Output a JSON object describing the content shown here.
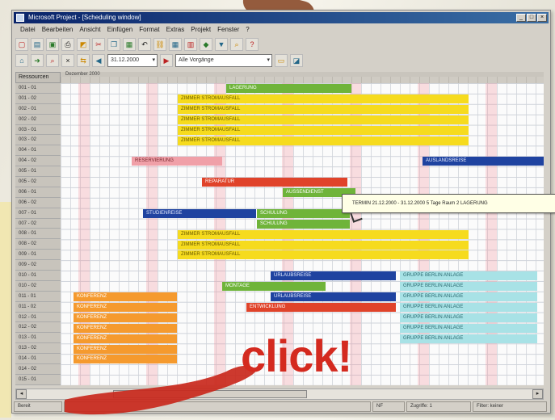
{
  "window": {
    "title": "Microsoft Project - [Scheduling window]"
  },
  "menu": [
    "Datei",
    "Bearbeiten",
    "Ansicht",
    "Einfügen",
    "Format",
    "Extras",
    "Projekt",
    "Fenster",
    "?"
  ],
  "toolbar": {
    "select1": "31.12.2000",
    "select2": "Alle Vorgänge"
  },
  "grid": {
    "left_header": "Ressourcen",
    "top_header": "Dezember 2000",
    "rows": [
      "001 - 01",
      "001 - 02",
      "002 - 01",
      "002 - 02",
      "003 - 01",
      "003 - 02",
      "004 - 01",
      "004 - 02",
      "005 - 01",
      "005 - 02",
      "006 - 01",
      "006 - 02",
      "007 - 01",
      "007 - 02",
      "008 - 01",
      "008 - 02",
      "009 - 01",
      "009 - 02",
      "010 - 01",
      "010 - 02",
      "011 - 01",
      "011 - 02",
      "012 - 01",
      "012 - 02",
      "013 - 01",
      "013 - 02",
      "014 - 01",
      "014 - 02",
      "015 - 01"
    ]
  },
  "bars": [
    {
      "color": "green",
      "label": "LAGERUNG",
      "row": 0,
      "start": 205,
      "width": 155
    },
    {
      "color": "yellow",
      "label": "ZIMMER STROMAUSFALL",
      "row": 1,
      "start": 145,
      "width": 360
    },
    {
      "color": "yellow",
      "label": "ZIMMER STROMAUSFALL",
      "row": 2,
      "start": 145,
      "width": 360
    },
    {
      "color": "yellow",
      "label": "ZIMMER STROMAUSFALL",
      "row": 3,
      "start": 145,
      "width": 360
    },
    {
      "color": "yellow",
      "label": "ZIMMER STROMAUSFALL",
      "row": 4,
      "start": 145,
      "width": 360
    },
    {
      "color": "yellow",
      "label": "ZIMMER STROMAUSFALL",
      "row": 5,
      "start": 145,
      "width": 360
    },
    {
      "color": "pink",
      "label": "RESERVIERUNG",
      "row": 7,
      "start": 88,
      "width": 112
    },
    {
      "color": "blue",
      "label": "AUSLANDSREISE",
      "row": 7,
      "start": 448,
      "width": 150
    },
    {
      "color": "red",
      "label": "REPARATUR",
      "row": 9,
      "start": 175,
      "width": 180
    },
    {
      "color": "green",
      "label": "AUSSENDIENST",
      "row": 10,
      "start": 275,
      "width": 90
    },
    {
      "color": "blue",
      "label": "STUDIENREISE",
      "row": 12,
      "start": 102,
      "width": 140
    },
    {
      "color": "green",
      "label": "SCHULUNG",
      "row": 12,
      "start": 243,
      "width": 115
    },
    {
      "color": "green",
      "label": "SCHULUNG",
      "row": 13,
      "start": 243,
      "width": 115
    },
    {
      "color": "yellow",
      "label": "ZIMMER STROMAUSFALL",
      "row": 14,
      "start": 145,
      "width": 360
    },
    {
      "color": "yellow",
      "label": "ZIMMER STROMAUSFALL",
      "row": 15,
      "start": 145,
      "width": 360
    },
    {
      "color": "yellow",
      "label": "ZIMMER STROMAUSFALL",
      "row": 16,
      "start": 145,
      "width": 360
    },
    {
      "color": "blue",
      "label": "URLAUBSREISE",
      "row": 18,
      "start": 260,
      "width": 155
    },
    {
      "color": "cyan",
      "label": "GRUPPE BERLIN ANLAGE",
      "row": 18,
      "start": 420,
      "width": 170
    },
    {
      "color": "green",
      "label": "MONTAGE",
      "row": 19,
      "start": 200,
      "width": 128
    },
    {
      "color": "cyan",
      "label": "GRUPPE BERLIN ANLAGE",
      "row": 19,
      "start": 420,
      "width": 170
    },
    {
      "color": "orange",
      "label": "KONFERENZ",
      "row": 20,
      "start": 16,
      "width": 128
    },
    {
      "color": "blue",
      "label": "URLAUBSREISE",
      "row": 20,
      "start": 260,
      "width": 155
    },
    {
      "color": "cyan",
      "label": "GRUPPE BERLIN ANLAGE",
      "row": 20,
      "start": 420,
      "width": 170
    },
    {
      "color": "orange",
      "label": "KONFERENZ",
      "row": 21,
      "start": 16,
      "width": 128
    },
    {
      "color": "red",
      "label": "ENTWICKLUNG",
      "row": 21,
      "start": 230,
      "width": 185
    },
    {
      "color": "cyan",
      "label": "GRUPPE BERLIN ANLAGE",
      "row": 21,
      "start": 420,
      "width": 170
    },
    {
      "color": "orange",
      "label": "KONFERENZ",
      "row": 22,
      "start": 16,
      "width": 128
    },
    {
      "color": "cyan",
      "label": "GRUPPE BERLIN ANLAGE",
      "row": 22,
      "start": 420,
      "width": 170
    },
    {
      "color": "orange",
      "label": "KONFERENZ",
      "row": 23,
      "start": 16,
      "width": 128
    },
    {
      "color": "cyan",
      "label": "GRUPPE BERLIN ANLAGE",
      "row": 23,
      "start": 420,
      "width": 170
    },
    {
      "color": "orange",
      "label": "KONFERENZ",
      "row": 24,
      "start": 16,
      "width": 128
    },
    {
      "color": "cyan",
      "label": "GRUPPE BERLIN ANLAGE",
      "row": 24,
      "start": 420,
      "width": 170
    },
    {
      "color": "orange",
      "label": "KONFERENZ",
      "row": 25,
      "start": 16,
      "width": 128
    },
    {
      "color": "orange",
      "label": "KONFERENZ",
      "row": 26,
      "start": 16,
      "width": 128
    }
  ],
  "tooltip": {
    "text": "TERMIN 21.12.2000 - 31.12.2000  5 Tage  Raum 2  LAGERUNG"
  },
  "status": [
    "Bereit",
    "",
    "NF",
    "Zugriffe: 1",
    "Filter: keiner"
  ],
  "overlay": {
    "click_text": "click",
    "exclaim": "!"
  }
}
